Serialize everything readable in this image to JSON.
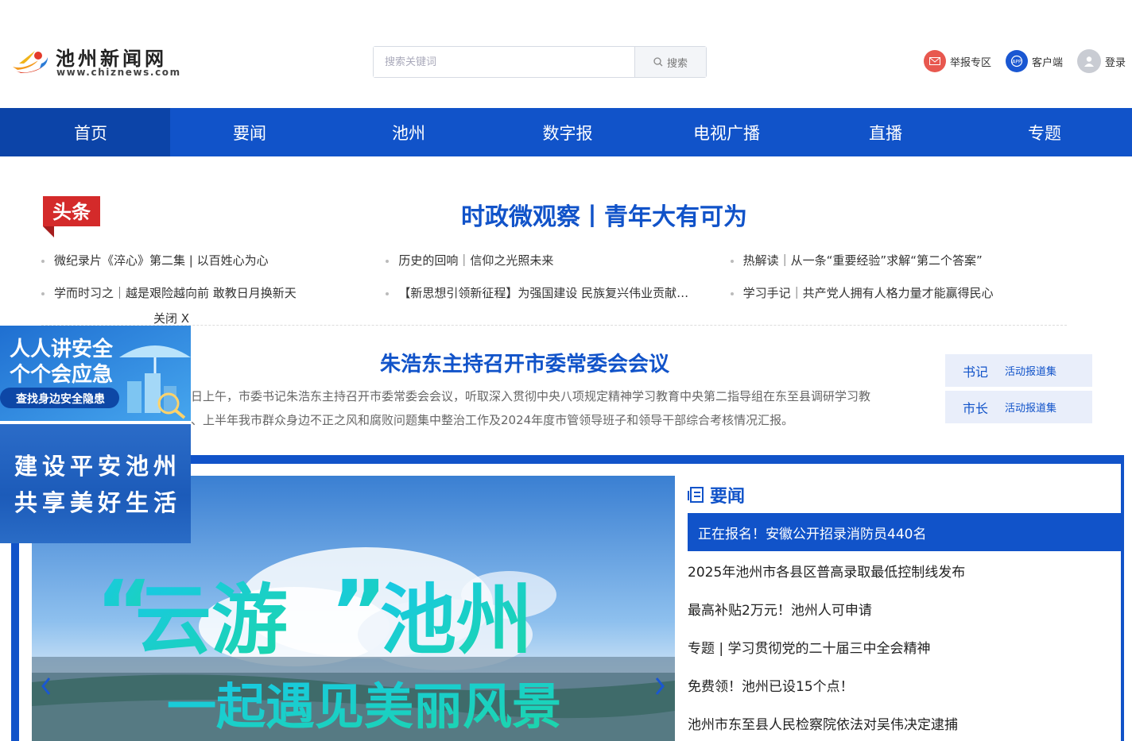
{
  "header": {
    "logo_name": "池州新闻网",
    "logo_url": "www.chiznews.com",
    "search_placeholder": "搜索关键词",
    "search_button": "搜索",
    "links": [
      {
        "label": "举报专区",
        "icon": "mail-icon",
        "color": "#e8584f"
      },
      {
        "label": "客户端",
        "icon": "app-icon",
        "color": "#1a57d2"
      },
      {
        "label": "登录",
        "icon": "user-icon",
        "color": "#c9ccd3"
      }
    ]
  },
  "nav": {
    "items": [
      "首页",
      "要闻",
      "池州",
      "数字报",
      "电视广播",
      "直播",
      "专题"
    ],
    "active_index": 0
  },
  "headline": {
    "badge": "头条",
    "title": "时政微观察丨青年大有可为",
    "links": [
      [
        "微纪录片《淬心》第二集 | 以百姓心为心",
        "历史的回响｜信仰之光照未来",
        "热解读｜从一条“重要经验”求解“第二个答案”"
      ],
      [
        "学而时习之｜越是艰险越向前 敢教日月换新天",
        "【新思想引领新征程】为强国建设 民族复兴伟业贡献…",
        "学习手记｜共产党人拥有人格力量才能赢得民心"
      ]
    ]
  },
  "lead": {
    "title": "朱浩东主持召开市委常委会会议",
    "summary": "日上午，市委书记朱浩东主持召开市委常委会会议，听取深入贯彻中央八项规定精神学习教育中央第二指导组在东至县调研学习教",
    "summary2": "、上半年我市群众身边不正之风和腐败问题集中整治工作及2024年度市管领导班子和领导干部综合考核情况汇报。"
  },
  "side_tags": [
    {
      "name": "书记",
      "link": "活动报道集"
    },
    {
      "name": "市长",
      "link": "活动报道集"
    }
  ],
  "ads": {
    "close": "关闭 X",
    "ad1_line1": "人人讲安全",
    "ad1_line2": "个个会应急",
    "ad1_line3": "查找身边安全隐患",
    "ad2_line1": "建设平安池州",
    "ad2_line2": "共享美好生活"
  },
  "slider": {
    "title_quote_open": "“",
    "title_main": "云游",
    "title_quote_close": "”",
    "title_place": "池州",
    "subtitle": "一起遇见美丽风景"
  },
  "news": {
    "heading": "要闻",
    "items": [
      "正在报名！安徽公开招录消防员440名",
      "2025年池州市各县区普高录取最低控制线发布",
      "最高补贴2万元！池州人可申请",
      "专题 | 学习贯彻党的二十届三中全会精神",
      "免费领！池州已设15个点！",
      "池州市东至县人民检察院依法对吴伟决定逮捕"
    ],
    "highlight_index": 0
  },
  "colors": {
    "brand": "#1153c9",
    "brand_dark": "#0c44a8",
    "badge_red": "#d42a2a"
  }
}
